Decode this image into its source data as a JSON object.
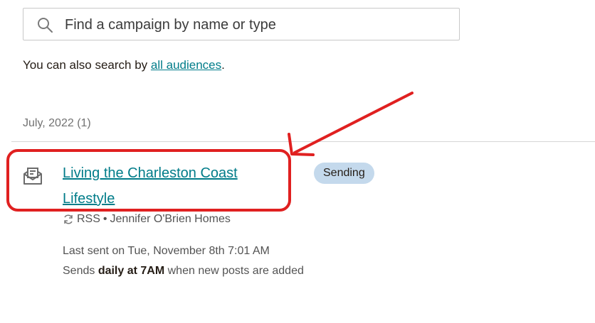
{
  "search": {
    "placeholder": "Find a campaign by name or type",
    "value": ""
  },
  "helper": {
    "prefix": "You can also search by ",
    "link": "all audiences",
    "suffix": "."
  },
  "group": {
    "label": "July, 2022 (1)"
  },
  "campaign": {
    "title": "Living the Charleston Coast Lifestyle",
    "status": "Sending",
    "type_label": "RSS",
    "separator": "•",
    "audience": "Jennifer O'Brien Homes",
    "last_sent": "Last sent on Tue, November 8th 7:01 AM",
    "sends_prefix": "Sends ",
    "sends_bold": "daily at 7AM",
    "sends_suffix": " when new posts are added"
  },
  "colors": {
    "link": "#007c89",
    "badge": "#c4d9ec",
    "annotation": "#e02020"
  }
}
